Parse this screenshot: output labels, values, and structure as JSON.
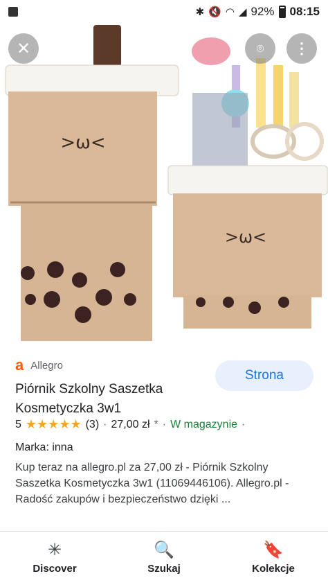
{
  "status_bar": {
    "battery": "92%",
    "time": "08:15"
  },
  "image": {
    "close_glyph": "✕",
    "lens_glyph": "⌾",
    "more_glyph": "⋮"
  },
  "result": {
    "source": "Allegro",
    "source_logo": "a",
    "visit_button": "Strona",
    "title": "Piórnik Szkolny Saszetka Kosmetyczka 3w1",
    "rating_value": "5",
    "rating_stars": "★★★★★",
    "rating_count": "(3)",
    "separator": "·",
    "price": "27,00 zł",
    "price_marker": "*",
    "availability": "W magazynie",
    "brand": "Marka: inna",
    "description": "Kup teraz na allegro.pl za 27,00 zł - Piórnik Szkolny Saszetka Kosmetyczka 3w1 (11069446106). Allegro.pl - Radość zakupów i bezpieczeństwo dzięki ..."
  },
  "bottom_nav": {
    "items": [
      {
        "label": "Discover",
        "icon": "asterisk-icon",
        "glyph": "✳"
      },
      {
        "label": "Szukaj",
        "icon": "search-icon",
        "glyph": "🔍"
      },
      {
        "label": "Kolekcje",
        "icon": "bookmark-icon",
        "glyph": "🔖"
      }
    ]
  },
  "colors": {
    "accent": "#1a73e8",
    "allegro": "#ff5a00",
    "in_stock": "#188038",
    "star": "#f5a623"
  }
}
